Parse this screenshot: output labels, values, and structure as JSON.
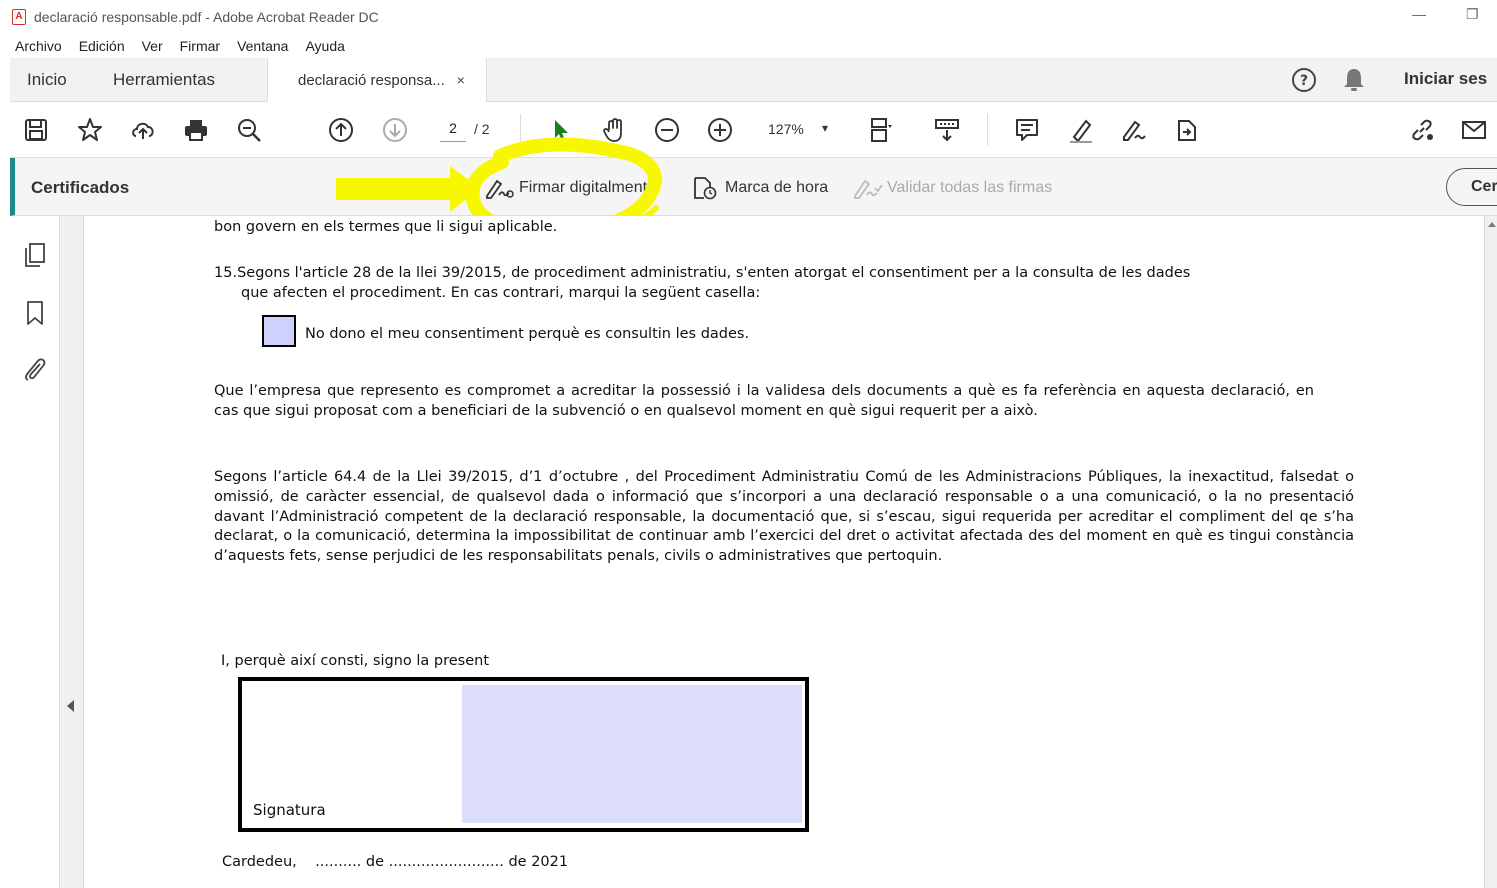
{
  "window": {
    "title": "declaració responsable.pdf - Adobe Acrobat Reader DC",
    "minimize_glyph": "—",
    "restore_glyph": "❐"
  },
  "menu": [
    "Archivo",
    "Edición",
    "Ver",
    "Firmar",
    "Ventana",
    "Ayuda"
  ],
  "tabs": {
    "home": "Inicio",
    "tools": "Herramientas",
    "document": "declaració responsa...",
    "close_glyph": "×"
  },
  "header": {
    "signin": "Iniciar ses"
  },
  "toolbar": {
    "page_current": "2",
    "page_total": "/ 2",
    "zoom": "127%",
    "zoom_caret": "▾",
    "icons": [
      "save-icon",
      "bookmark-star-icon",
      "upload-cloud-icon",
      "print-icon",
      "zoom-search-icon",
      "page-up-icon",
      "page-down-icon",
      "select-arrow-icon",
      "hand-icon",
      "zoom-out-icon",
      "zoom-in-icon",
      "page-fit-icon",
      "scroll-mode-icon",
      "comment-icon",
      "highlight-icon",
      "sign-icon",
      "share-icon",
      "link-icon",
      "email-icon"
    ]
  },
  "certificates": {
    "title": "Certificados",
    "sign_digitally": "Firmar digitalmente",
    "timestamp": "Marca de hora",
    "validate_all": "Validar todas las firmas",
    "close": "Cer"
  },
  "colors": {
    "accent": "#1a8a8a",
    "annotation": "#f7f700",
    "form_field": "#cfd0fb",
    "select_arrow": "#1b7f1b"
  },
  "document": {
    "line_top": "bon govern en els termes que li sigui aplicable.",
    "item15_number": "15.",
    "item15_line1": "Segons l'article 28 de la llei 39/2015, de procediment administratiu, s'enten  atorgat el consentiment per a la consulta de les dades",
    "item15_line2": "que afecten el procediment. En cas contrari, marqui la següent casella:",
    "checkbox_label": "No dono el meu consentiment perquè es consultin les dades.",
    "para1": "Que l’empresa que represento es compromet a acreditar la possessió i la validesa dels documents a què es fa referència en aquesta declaració, en cas que sigui proposat com a beneficiari de la subvenció o en qualsevol moment en què sigui requerit per a això.",
    "para2": "Segons l’article 64.4 de la Llei 39/2015, d’1 d’octubre , del Procediment Administratiu Comú de les Administracions Públiques, la inexactitud, falsedat o omissió, de caràcter essencial, de qualsevol dada o informació que s’incorpori a una declaració responsable o a una comunicació, o la no presentació davant l’Administració competent de la declaració responsable, la documentació que, si s’escau, sigui requerida per acreditar el compliment del qe s’ha declarat, o la comunicació, determina la impossibilitat de continuar amb l’exercici del dret o activitat afectada des del moment en què es tingui constància d’aquests fets, sense perjudici de les responsabilitats penals, civils o administratives que pertoquin.",
    "sign_intro": "I, perquè així consti, signo la present",
    "signature_label": "Signatura",
    "date_line": "Cardedeu,    .......... de ......................... de 2021"
  }
}
